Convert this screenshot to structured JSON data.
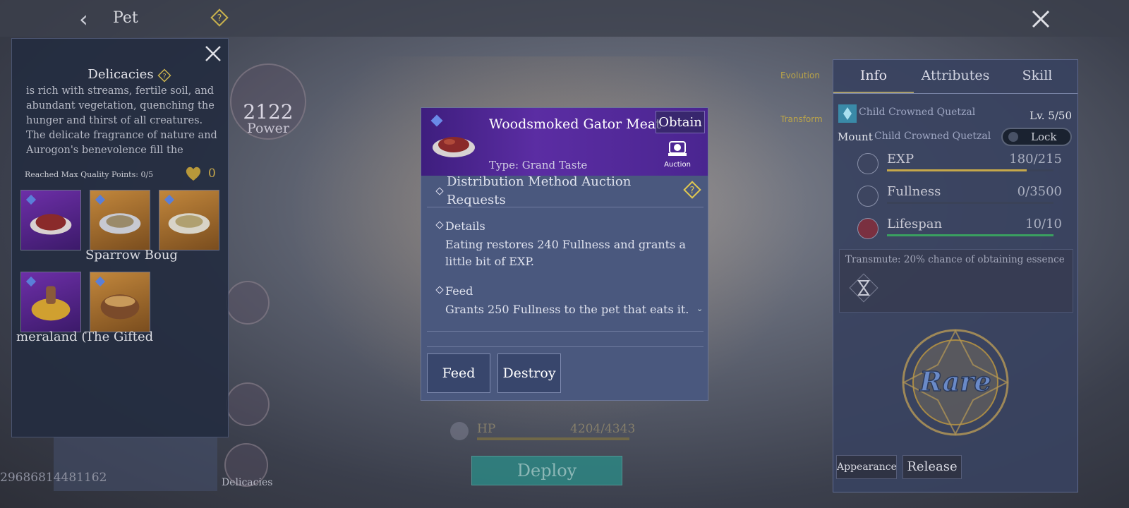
{
  "topbar": {
    "back_icon": "chevron-left-icon",
    "title": "Pet",
    "help_icon": "question-icon",
    "close_icon": "close-icon"
  },
  "left_panel": {
    "title": "Delicacies",
    "description": "is rich with streams, fertile soil, and abundant vegetation, quenching the hunger and thirst of all creatures. The delicate fragrance of nature and Aurogon's benevolence fill the",
    "max_quality": "Reached Max Quality Points: 0/5",
    "heart_value": "0",
    "slot_labels": [
      "Sparrow Boug",
      "meraland (",
      "The Gifted"
    ]
  },
  "background": {
    "power_value": "2122",
    "power_label": "Power",
    "id_number": "29686814481162",
    "delicacies_label": "Delicacies",
    "evolution_label": "Evolution",
    "transform_label": "Transform"
  },
  "item": {
    "name": "Woodsmoked Gator Meat",
    "obtain_label": "Obtain",
    "auction_label": "Auction",
    "type": "Type: Grand Taste",
    "distribution": "Distribution Method    Auction Requests",
    "details_title": "Details",
    "details_text": "Eating restores 240 Fullness and grants a little bit of EXP.",
    "feed_title": "Feed",
    "feed_text": "Grants 250 Fullness to the pet that eats it.",
    "feed_button": "Feed",
    "destroy_button": "Destroy"
  },
  "hp": {
    "label": "HP",
    "value": "4204/4343"
  },
  "deploy_label": "Deploy",
  "right_panel": {
    "tabs": [
      "Info",
      "Attributes",
      "Skill"
    ],
    "pet_name": "Child Crowned Quetzal",
    "level": "Lv. 5/50",
    "mount_label": "Mount",
    "mount_name": "Child Crowned Quetzal",
    "lock_label": "Lock",
    "stats": [
      {
        "name": "EXP",
        "value": "180/215",
        "fraction": 0.837,
        "color": "#c6a84a"
      },
      {
        "name": "Fullness",
        "value": "0/3500",
        "fraction": 0,
        "color": "#7ab0d0"
      },
      {
        "name": "Lifespan",
        "value": "10/10",
        "fraction": 1,
        "color": "#3aa060"
      }
    ],
    "transmute": "Transmute: 20% chance of obtaining essence",
    "rarity": "Rare",
    "appearance_button": "Appearance",
    "release_button": "Release"
  }
}
